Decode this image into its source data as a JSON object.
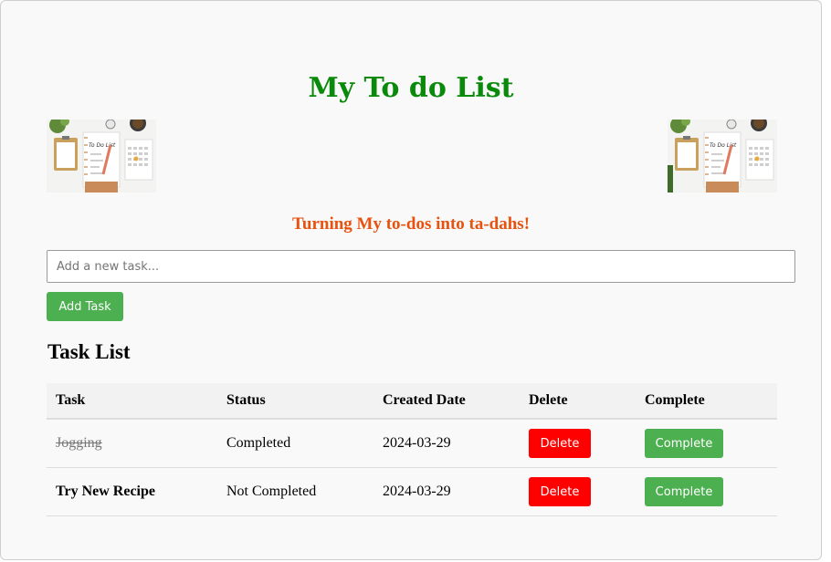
{
  "header": {
    "title": "My To do List",
    "tagline": "Turning My to-dos into ta-dahs!",
    "banner_text": "To Do List"
  },
  "form": {
    "placeholder": "Add a new task...",
    "value": "",
    "add_button_label": "Add Task"
  },
  "task_list": {
    "heading": "Task List",
    "columns": [
      "Task",
      "Status",
      "Created Date",
      "Delete",
      "Complete"
    ],
    "rows": [
      {
        "task": "Jogging",
        "status": "Completed",
        "created_date": "2024-03-29",
        "delete_label": "Delete",
        "complete_label": "Complete",
        "completed": true
      },
      {
        "task": "Try New Recipe",
        "status": "Not Completed",
        "created_date": "2024-03-29",
        "delete_label": "Delete",
        "complete_label": "Complete",
        "completed": false
      }
    ]
  },
  "colors": {
    "title": "#0a8a0a",
    "tagline": "#e8510e",
    "add_button": "#4caf50",
    "delete_button": "#ff0000",
    "complete_button": "#4caf50"
  }
}
